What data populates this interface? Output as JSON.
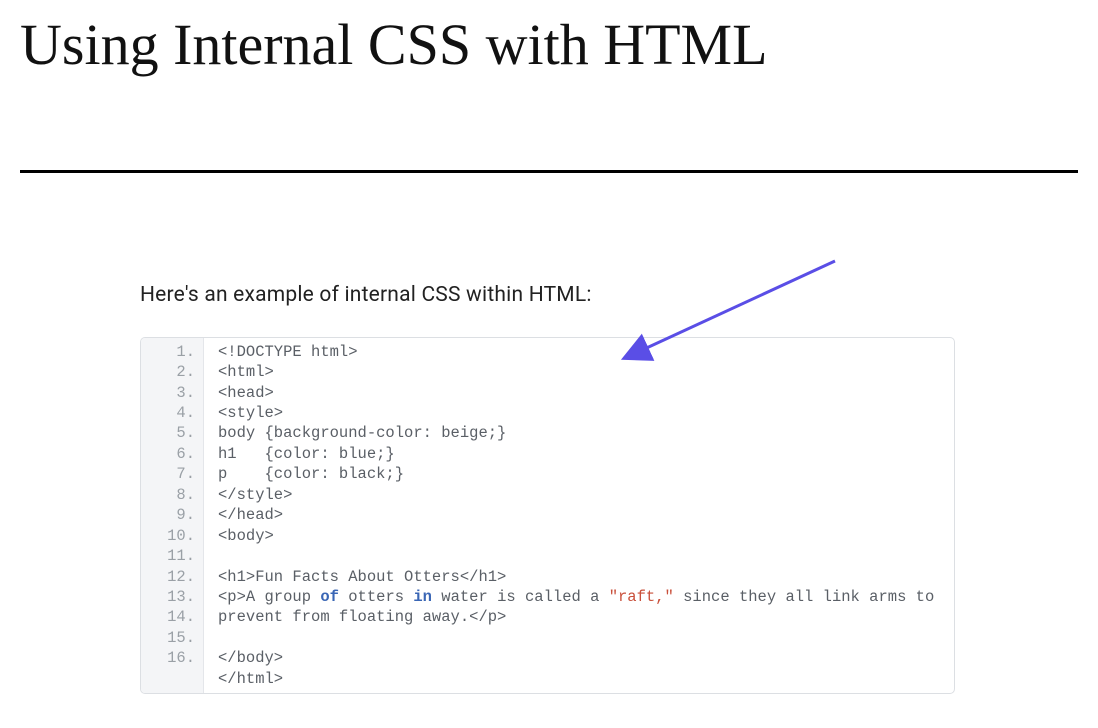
{
  "title": "Using Internal CSS with HTML",
  "lead": "Here's an example of internal CSS within HTML:",
  "arrow_color": "#5a4ee6",
  "code": {
    "line_numbers": [
      "1.",
      "2.",
      "3.",
      "4.",
      "5.",
      "6.",
      "7.",
      "8.",
      "9.",
      "10.",
      "11.",
      "12.",
      "13.",
      "14.",
      "15.",
      "16."
    ],
    "lines": [
      [
        {
          "t": "norm",
          "v": "<!DOCTYPE html>"
        }
      ],
      [
        {
          "t": "norm",
          "v": "<html>"
        }
      ],
      [
        {
          "t": "norm",
          "v": "<head>"
        }
      ],
      [
        {
          "t": "norm",
          "v": "<style>"
        }
      ],
      [
        {
          "t": "norm",
          "v": "body {background-color: beige;}"
        }
      ],
      [
        {
          "t": "norm",
          "v": "h1   {color: blue;}"
        }
      ],
      [
        {
          "t": "norm",
          "v": "p    {color: black;}"
        }
      ],
      [
        {
          "t": "norm",
          "v": "</style>"
        }
      ],
      [
        {
          "t": "norm",
          "v": "</head>"
        }
      ],
      [
        {
          "t": "norm",
          "v": "<body>"
        }
      ],
      [
        {
          "t": "norm",
          "v": ""
        }
      ],
      [
        {
          "t": "norm",
          "v": "<h1>Fun Facts About Otters</h1>"
        }
      ],
      [
        {
          "t": "norm",
          "v": "<p>A group "
        },
        {
          "t": "kw",
          "v": "of"
        },
        {
          "t": "norm",
          "v": " otters "
        },
        {
          "t": "kw",
          "v": "in"
        },
        {
          "t": "norm",
          "v": " water is called a "
        },
        {
          "t": "str",
          "v": "\"raft,\""
        },
        {
          "t": "norm",
          "v": " since they all link arms to prevent from floating away.</p>"
        }
      ],
      [
        {
          "t": "norm",
          "v": ""
        }
      ],
      [
        {
          "t": "norm",
          "v": "</body>"
        }
      ],
      [
        {
          "t": "norm",
          "v": "</html>"
        }
      ]
    ]
  }
}
